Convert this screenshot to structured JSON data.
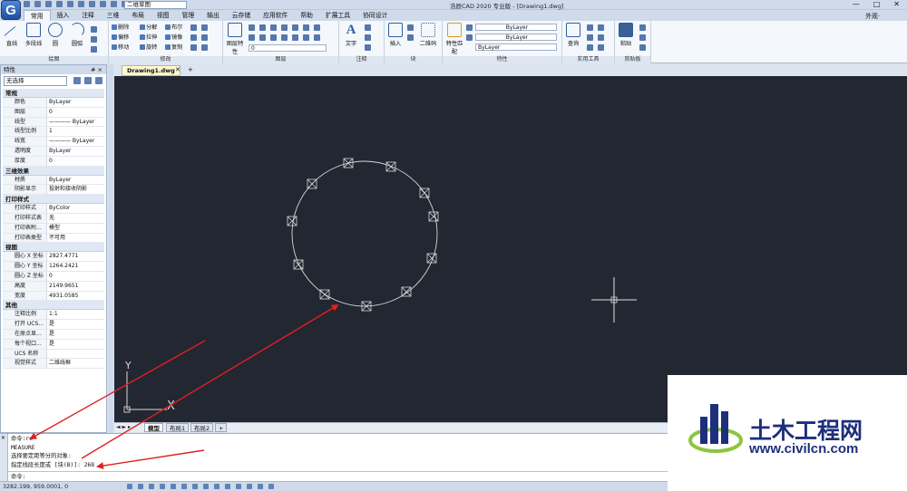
{
  "app": {
    "logo_letter": "G",
    "title": "浩辰CAD 2020 专业版 - [Drawing1.dwg]",
    "workspace": "二维草图",
    "window_controls": [
      "—",
      "□",
      "✕"
    ]
  },
  "ribbon_tabs": [
    "常用",
    "插入",
    "注释",
    "三维",
    "布局",
    "视图",
    "管理",
    "输出",
    "云存储",
    "应用软件",
    "帮助",
    "扩展工具",
    "协同设计"
  ],
  "ribbon_tab_right": "外观·",
  "ribbon": {
    "draw": {
      "title": "绘图",
      "buttons": [
        "直线",
        "多段线",
        "圆",
        "圆弧"
      ]
    },
    "modify": {
      "title": "修改",
      "buttons": [
        "删除",
        "分解",
        "布尔",
        "偏移",
        "拉伸",
        "镜像",
        "移动",
        "旋转",
        "复制"
      ]
    },
    "layers": {
      "title": "图层",
      "big_label": "图层特性",
      "current_layer": "0"
    },
    "annotation": {
      "title": "注释",
      "big_label": "文字"
    },
    "block": {
      "title": "块",
      "buttons": [
        "插入",
        "二维码"
      ]
    },
    "properties": {
      "title": "特性",
      "big_label": "特性匹配",
      "combos": [
        "ByLayer",
        "ByLayer",
        "ByLayer"
      ]
    },
    "utilities": {
      "title": "实用工具",
      "big_label": "查询"
    },
    "clipboard": {
      "title": "剪贴板",
      "big_label": "粘贴"
    }
  },
  "document_tab": {
    "label": "Drawing1.dwg",
    "close": "✕",
    "add": "+"
  },
  "properties_palette": {
    "title": "特性",
    "title_controls": "# ×",
    "selection": "无选择",
    "sections": [
      {
        "name": "常规",
        "rows": [
          {
            "k": "颜色",
            "v": "ByLayer"
          },
          {
            "k": "图层",
            "v": "0"
          },
          {
            "k": "线型",
            "v": "———— ByLayer"
          },
          {
            "k": "线型比例",
            "v": "1"
          },
          {
            "k": "线宽",
            "v": "———— ByLayer"
          },
          {
            "k": "透明度",
            "v": "ByLayer"
          },
          {
            "k": "厚度",
            "v": "0"
          }
        ]
      },
      {
        "name": "三维效果",
        "rows": [
          {
            "k": "材质",
            "v": "ByLayer"
          },
          {
            "k": "阴影显示",
            "v": "投射和接收阴影"
          }
        ]
      },
      {
        "name": "打印样式",
        "rows": [
          {
            "k": "打印样式",
            "v": "ByColor"
          },
          {
            "k": "打印样式表",
            "v": "无"
          },
          {
            "k": "打印表附...",
            "v": "模型"
          },
          {
            "k": "打印表类型",
            "v": "不可用"
          }
        ]
      },
      {
        "name": "视图",
        "rows": [
          {
            "k": "圆心 X 坐标",
            "v": "2827.4771"
          },
          {
            "k": "圆心 Y 坐标",
            "v": "1264.2421"
          },
          {
            "k": "圆心 Z 坐标",
            "v": "0"
          },
          {
            "k": "高度",
            "v": "2149.9651"
          },
          {
            "k": "宽度",
            "v": "4931.0585"
          }
        ]
      },
      {
        "name": "其他",
        "rows": [
          {
            "k": "注释比例",
            "v": "1:1"
          },
          {
            "k": "打开 UCS...",
            "v": "是"
          },
          {
            "k": "在原点显...",
            "v": "是"
          },
          {
            "k": "每个视口...",
            "v": "是"
          },
          {
            "k": "UCS 名称",
            "v": ""
          },
          {
            "k": "视觉样式",
            "v": "二维线框"
          }
        ]
      }
    ]
  },
  "canvas": {
    "ucs_x": "X",
    "ucs_y": "Y",
    "background": "#222731",
    "drawing_color": "#d8d8d8"
  },
  "layout_tabs": [
    "模型",
    "布局1",
    "布局2",
    "+"
  ],
  "command_history": [
    "命令:re",
    "MEASURE",
    "选择要定距等分的对象:",
    "指定线段长度或 [块(B)]: 268"
  ],
  "command_prompt": "命令:",
  "status": {
    "coordinates": "3282.199, 959.0001, 0",
    "right_text": "AD"
  },
  "annotation_color": "#e02020",
  "watermark": {
    "title": "土木工程网",
    "url": "www.civilcn.com",
    "brand_blue": "#1d2f7a",
    "brand_green": "#8cc63f"
  }
}
